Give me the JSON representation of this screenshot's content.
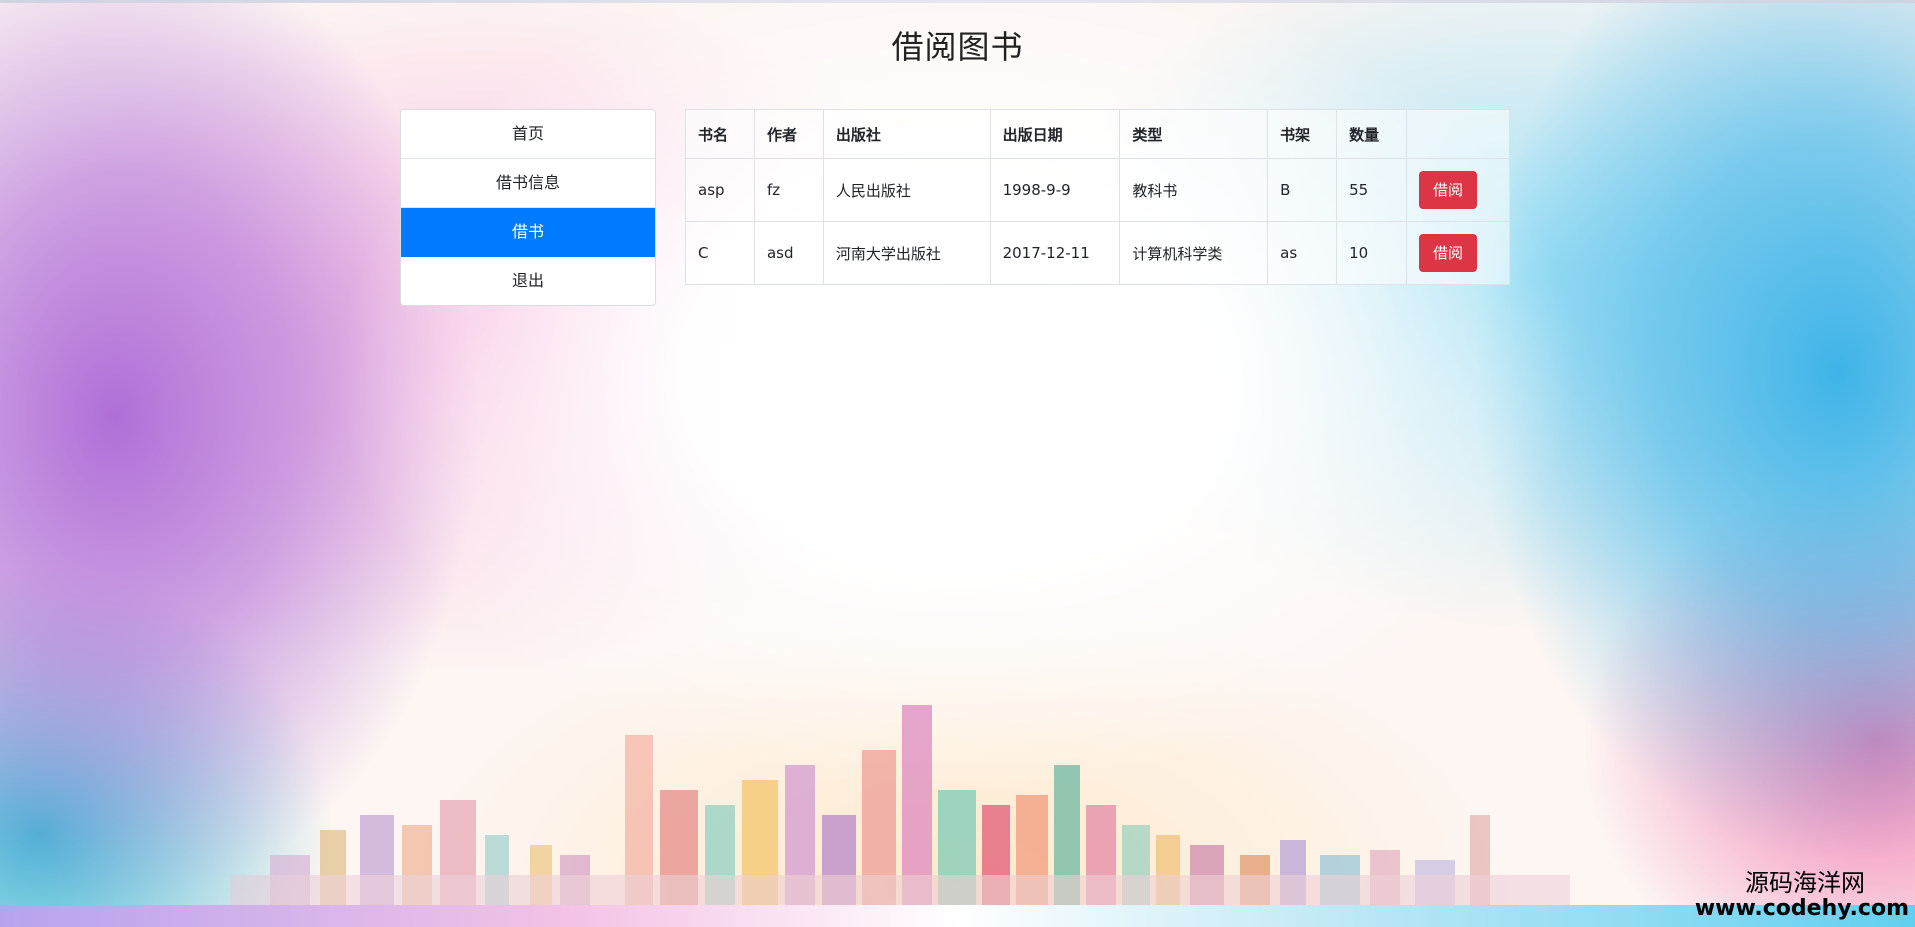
{
  "page": {
    "title": "借阅图书"
  },
  "nav": {
    "items": [
      {
        "label": "首页",
        "active": false
      },
      {
        "label": "借书信息",
        "active": false
      },
      {
        "label": "借书",
        "active": true
      },
      {
        "label": "退出",
        "active": false
      }
    ]
  },
  "table": {
    "headers": [
      "书名",
      "作者",
      "出版社",
      "出版日期",
      "类型",
      "书架",
      "数量",
      ""
    ],
    "rows": [
      {
        "name": "asp",
        "author": "fz",
        "publisher": "人民出版社",
        "date": "1998-9-9",
        "type": "教科书",
        "shelf": "B",
        "count": "55",
        "action": "借阅"
      },
      {
        "name": "C",
        "author": "asd",
        "publisher": "河南大学出版社",
        "date": "2017-12-11",
        "type": "计算机科学类",
        "shelf": "as",
        "count": "10",
        "action": "借阅"
      }
    ]
  },
  "watermark": {
    "name": "源码海洋网",
    "url": "www.codehy.com"
  },
  "colors": {
    "active_nav": "#007bff",
    "borrow_button": "#dc3545"
  }
}
